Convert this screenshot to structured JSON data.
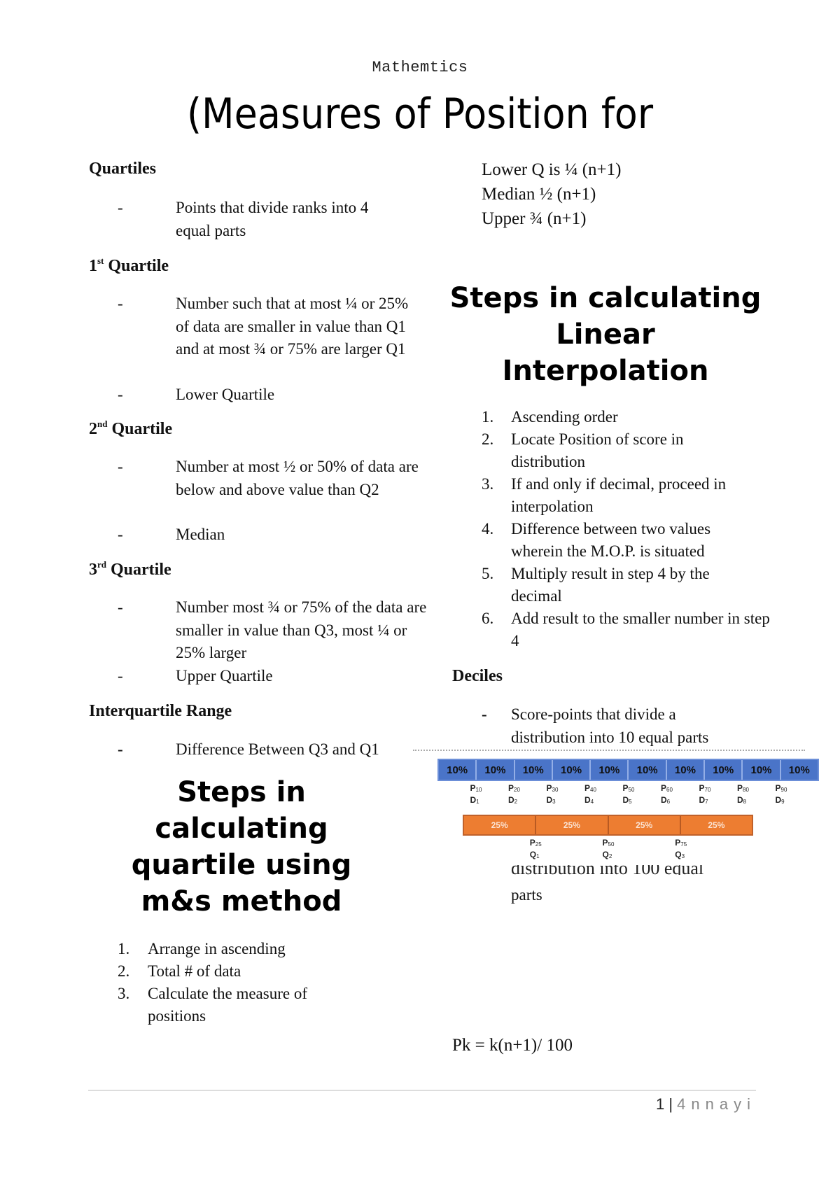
{
  "header": {
    "running_title": "Mathemtics"
  },
  "title": "(Measures of Position for",
  "left_column": {
    "quartiles": {
      "heading": "Quartiles",
      "items": [
        "Points that divide ranks into 4 equal parts"
      ]
    },
    "first_quartile": {
      "heading_num": "1",
      "heading_sup": "st",
      "heading_text": " Quartile",
      "items": [
        "Number such that at most ¼ or 25% of data are smaller in value than Q1 and at most ¾ or 75% are larger Q1",
        "Lower Quartile"
      ]
    },
    "second_quartile": {
      "heading_num": "2",
      "heading_sup": "nd",
      "heading_text": " Quartile",
      "items": [
        "Number at most ½ or 50% of data are below and above value than Q2",
        "Median"
      ]
    },
    "third_quartile": {
      "heading_num": "3",
      "heading_sup": "rd",
      "heading_text": " Quartile",
      "items": [
        "Number most ¾ or 75% of the data are smaller in value than Q3, most ¼ or 25% larger",
        "Upper Quartile"
      ]
    },
    "iqr": {
      "heading": "Interquartile Range",
      "items": [
        "Difference Between Q3 and Q1"
      ]
    },
    "ms_method": {
      "heading": "Steps in calculating quartile using m&s method",
      "steps": [
        "Arrange in ascending",
        "Total # of data",
        "Calculate the measure of positions"
      ]
    },
    "dash_symbol": "-"
  },
  "right_column": {
    "formulas": [
      "Lower Q is ¼ (n+1)",
      "Median ½ (n+1)",
      "Upper ¾ (n+1)"
    ],
    "interpolation": {
      "heading": "Steps in calculating Linear Interpolation",
      "steps": [
        "Ascending order",
        "Locate Position of score in distribution",
        "If and only if decimal, proceed in interpolation",
        "Difference between two values wherein the M.O.P. is situated",
        "Multiply result in step 4 by the decimal",
        "Add result to the smaller number in step 4"
      ]
    },
    "deciles": {
      "heading": "Deciles",
      "items": [
        "Score-points that divide a distribution into 10 equal parts"
      ]
    },
    "percentile_cut_text": "distribution into 100 equal",
    "percentile_tail": "parts",
    "percentile_formula": "Pk = k(n+1)/ 100"
  },
  "figure": {
    "decile_bar": {
      "segments": [
        "10%",
        "10%",
        "10%",
        "10%",
        "10%",
        "10%",
        "10%",
        "10%",
        "10%",
        "10%"
      ],
      "markers": [
        {
          "p": "P",
          "p_sub": "10",
          "d": "D",
          "d_sub": "1"
        },
        {
          "p": "P",
          "p_sub": "20",
          "d": "D",
          "d_sub": "2"
        },
        {
          "p": "P",
          "p_sub": "30",
          "d": "D",
          "d_sub": "3"
        },
        {
          "p": "P",
          "p_sub": "40",
          "d": "D",
          "d_sub": "4"
        },
        {
          "p": "P",
          "p_sub": "50",
          "d": "D",
          "d_sub": "5"
        },
        {
          "p": "P",
          "p_sub": "60",
          "d": "D",
          "d_sub": "6"
        },
        {
          "p": "P",
          "p_sub": "70",
          "d": "D",
          "d_sub": "7"
        },
        {
          "p": "P",
          "p_sub": "80",
          "d": "D",
          "d_sub": "8"
        },
        {
          "p": "P",
          "p_sub": "90",
          "d": "D",
          "d_sub": "9"
        }
      ],
      "color": "#4a74c8"
    },
    "quartile_bar": {
      "segments": [
        "25%",
        "25%",
        "25%",
        "25%"
      ],
      "markers": [
        {
          "p": "P",
          "p_sub": "25",
          "q": "Q",
          "q_sub": "1"
        },
        {
          "p": "P",
          "p_sub": "50",
          "q": "Q",
          "q_sub": "2"
        },
        {
          "p": "P",
          "p_sub": "75",
          "q": "Q",
          "q_sub": "3"
        }
      ],
      "color": "#ed7d31"
    }
  },
  "footer": {
    "page_number": "1",
    "separator": "|",
    "author": "4nnayi"
  }
}
